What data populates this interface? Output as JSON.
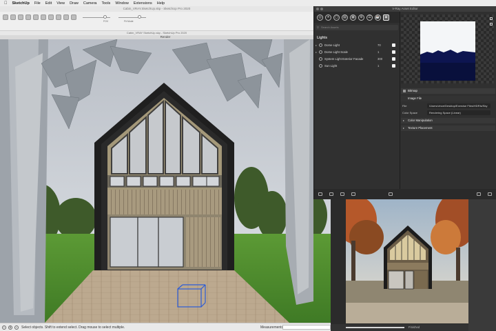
{
  "menubar": {
    "app": "SketchUp",
    "items": [
      "File",
      "Edit",
      "View",
      "Draw",
      "Camera",
      "Tools",
      "Window",
      "Extensions",
      "Help"
    ]
  },
  "sketchup": {
    "title": "Cabin_VRAY.SketchUp.skp - SketchUp Pro 2020",
    "subtitle": "Cabin_VRAY SketchUp.skp - SketchUp Pro 2020",
    "render_tab": "Render",
    "slider1_label": "FOV",
    "slider2_label": "Fit Mode"
  },
  "status": {
    "text": "Select objects. Shift to extend select. Drag mouse to select multiple.",
    "measurements_label": "Measurements"
  },
  "vray_editor": {
    "title": "V-Ray Asset Editor",
    "search_placeholder": "Search Assets",
    "lights_header": "Lights",
    "lights": [
      {
        "name": "Dome Light",
        "value": "70"
      },
      {
        "name": "Dome Light Scale",
        "value": "1"
      },
      {
        "name": "System Light Exterior Facade",
        "value": "300"
      },
      {
        "name": "Sun Light",
        "value": "1"
      }
    ],
    "bitmap_header": "Bitmap",
    "image_file_header": "Image File",
    "file_label": "File",
    "file_value": "/Users/vince/Desktop/Exercise Files/HDRIs/Sky",
    "color_space_label": "Color Space",
    "color_space_value": "Rendering Space (Linear)",
    "color_manipulation": "Color Manipulation",
    "texture_placement": "Texture Placement"
  },
  "framebuffer": {
    "status": "Finished"
  },
  "colors": {
    "sky": "#c9cfd6",
    "grass": "#4f8a2f",
    "roof": "#232323",
    "wood": "#a99a7e",
    "vray_bg": "#303030"
  }
}
